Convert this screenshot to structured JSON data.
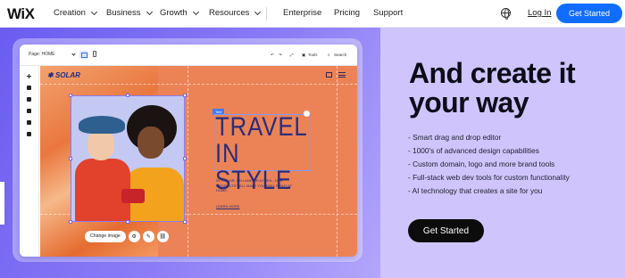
{
  "nav": {
    "logo": "WiX",
    "items": [
      {
        "label": "Creation"
      },
      {
        "label": "Business"
      },
      {
        "label": "Growth"
      },
      {
        "label": "Resources"
      }
    ],
    "links": [
      {
        "label": "Enterprise"
      },
      {
        "label": "Pricing"
      },
      {
        "label": "Support"
      }
    ],
    "login": "Log In",
    "cta": "Get Started",
    "globe_icon": "globe-icon"
  },
  "hero": {
    "headline": "And create it your way",
    "features": [
      "Smart drag and drop editor",
      "1000's of advanced design capabilities",
      "Custom domain, logo and more brand tools",
      "Full-stack web dev tools for custom functionality",
      "AI technology that creates a site for you"
    ],
    "cta": "Get Started"
  },
  "editor": {
    "page_selector": "Page: HOME",
    "tools_label": "Tools",
    "search_label": "Search",
    "site_logo": "SOLAR",
    "text_tag": "Text",
    "headline": "TRAVEL IN STYLE",
    "copy": "IN THE AIR, ON LAND OR AT SEA - OUR PRODUCTS WILL MAKE YOU FEEL RIGHT AT HOME.",
    "learn_more": "LEARN MORE",
    "change_image": "Change image"
  },
  "colors": {
    "brand_blue": "#116dff",
    "hero_purple": "#7b6cf3",
    "hero_lavender": "#cfc5fc",
    "canvas_orange": "#ec8356",
    "headline_navy": "#2b2d7a"
  }
}
